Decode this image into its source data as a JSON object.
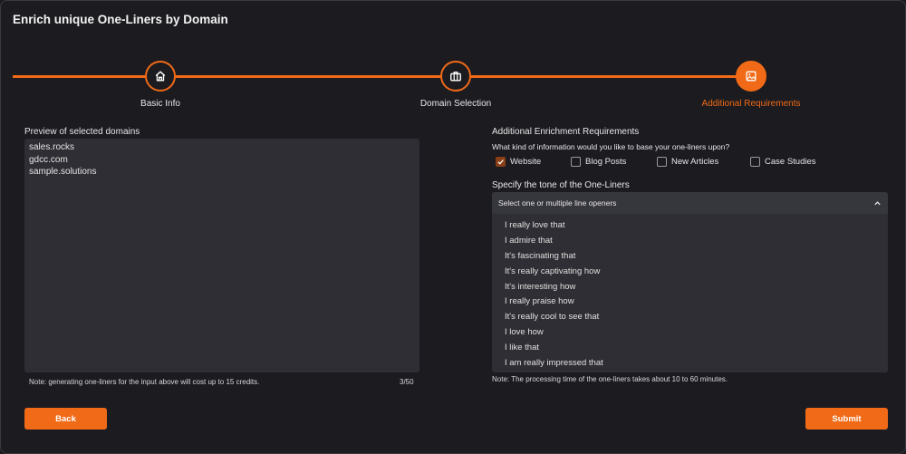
{
  "page": {
    "title": "Enrich unique One-Liners by Domain"
  },
  "stepper": {
    "steps": [
      {
        "label": "Basic Info",
        "icon": "home-icon",
        "state": "completed"
      },
      {
        "label": "Domain Selection",
        "icon": "briefcase-icon",
        "state": "completed"
      },
      {
        "label": "Additional Requirements",
        "icon": "image-icon",
        "state": "active"
      }
    ],
    "accent": "#f06a17"
  },
  "left": {
    "label": "Preview of selected domains",
    "domains": [
      "sales.rocks",
      "gdcc.com",
      "sample.solutions"
    ],
    "note": "Note: generating one-liners for the input above will cost up to 15 credits.",
    "count": "3/50"
  },
  "right": {
    "header": "Additional Enrichment Requirements",
    "question": "What kind of information would you like to base your one-liners upon?",
    "options": [
      {
        "label": "Website",
        "checked": true
      },
      {
        "label": "Blog Posts",
        "checked": false
      },
      {
        "label": "New Articles",
        "checked": false
      },
      {
        "label": "Case Studies",
        "checked": false
      }
    ],
    "tone_label": "Specify the tone of the One-Liners",
    "tone_placeholder": "Select one or multiple line openers",
    "openers": [
      "I really love that",
      "I admire that",
      "It's fascinating that",
      "It's really captivating how",
      "It's interesting how",
      "I really praise how",
      "It's really cool to see that",
      "I love how",
      "I like that",
      "I am really impressed that"
    ],
    "note": "Note: The processing time of the one-liners takes about 10 to 60 minutes."
  },
  "buttons": {
    "back": "Back",
    "submit": "Submit"
  }
}
